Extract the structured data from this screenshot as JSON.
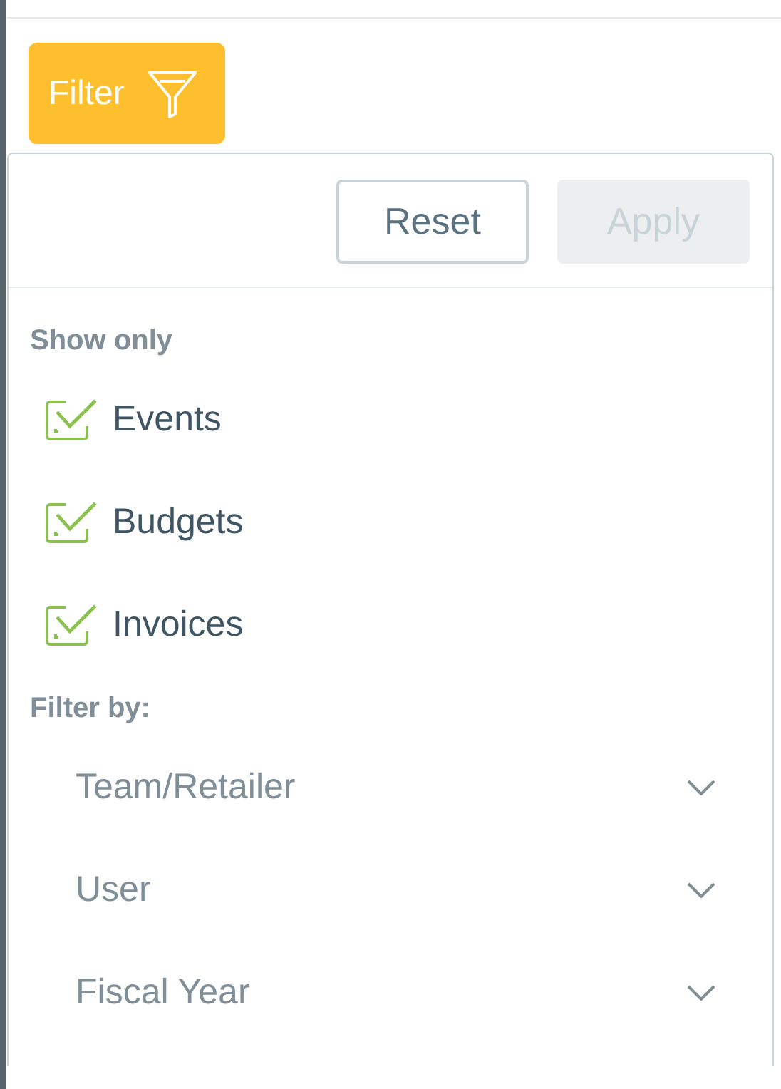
{
  "filter_button": {
    "label": "Filter"
  },
  "panel": {
    "buttons": [
      {
        "label": "Reset",
        "disabled": false
      },
      {
        "label": "Apply",
        "disabled": true
      }
    ],
    "show_only": {
      "title": "Show only",
      "options": [
        {
          "label": "Events",
          "checked": true
        },
        {
          "label": "Budgets",
          "checked": true
        },
        {
          "label": "Invoices",
          "checked": true
        }
      ]
    },
    "filter_by": {
      "title": "Filter by:",
      "dropdowns": [
        {
          "label": "Team/Retailer",
          "expanded": false
        },
        {
          "label": "User",
          "expanded": false
        },
        {
          "label": "Fiscal Year",
          "expanded": false
        }
      ]
    }
  }
}
